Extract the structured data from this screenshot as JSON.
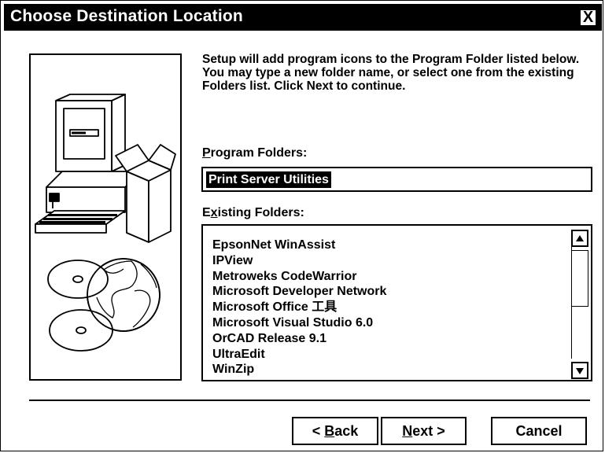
{
  "window": {
    "title": "Choose Destination Location",
    "close_label": "X"
  },
  "description": "Setup will add program icons to the Program Folder listed below. You may type a new folder name, or select one from the existing Folders list. Click Next to continue.",
  "program_folders": {
    "label_first": "P",
    "label_rest": "rogram Folders:",
    "value": "Print Server Utilities"
  },
  "existing_folders": {
    "label_first": "E",
    "label_x": "x",
    "label_rest": "isting Folders:",
    "items": [
      "EpsonNet WinAssist",
      "IPView",
      "Metroweks CodeWarrior",
      "Microsoft Developer Network",
      "Microsoft Office 工具",
      "Microsoft Visual Studio 6.0",
      "OrCAD Release 9.1",
      "UltraEdit",
      "WinZip"
    ]
  },
  "buttons": {
    "back_prefix": "< ",
    "back_key": "B",
    "back_rest": "ack",
    "next_key": "N",
    "next_rest": "ext >",
    "cancel": "Cancel"
  },
  "icons": {
    "illustration": "computer-box-globe-cds-illustration",
    "close": "close-icon",
    "scroll_up": "arrow-up-icon",
    "scroll_down": "arrow-down-icon"
  }
}
